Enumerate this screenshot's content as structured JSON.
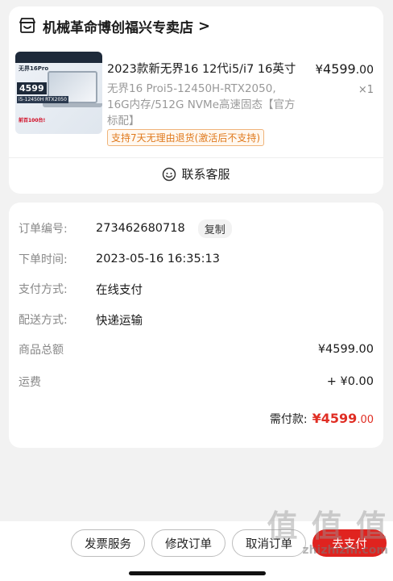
{
  "store": {
    "name": "机械革命博创福兴专卖店",
    "chevron": ">",
    "icon": "store-icon"
  },
  "product": {
    "title": "2023款新无界16 12代i5/i7 16英寸",
    "spec": "无界16 Proi5-12450H-RTX2050, 16G内存/512G NVMe高速固态【官方标配】",
    "price_currency": "¥",
    "price_int": "4599",
    "price_dec": ".00",
    "quantity": "×1",
    "return_policy": "支持7天无理由退货(激活后不支持)",
    "thumb": {
      "brand": "无界16Pro",
      "price": "4599",
      "spec": "i5-12450H RTX2050",
      "promo": "前百100台!"
    }
  },
  "service": {
    "label": "联系客服",
    "icon": "customer-service-icon"
  },
  "order": {
    "number_label": "订单编号:",
    "number": "273462680718",
    "copy_label": "复制",
    "time_label": "下单时间:",
    "time": "2023-05-16 16:35:13",
    "payment_label": "支付方式:",
    "payment": "在线支付",
    "delivery_label": "配送方式:",
    "delivery": "快递运输",
    "goods_total_label": "商品总额",
    "goods_total": "¥4599.00",
    "shipping_label": "运费",
    "shipping": "+ ¥0.00",
    "paid_label": "需付款:",
    "paid_currency": "¥",
    "paid_int": "4599",
    "paid_dec": ".00"
  },
  "actions": {
    "invoice": "发票服务",
    "modify": "修改订单",
    "cancel": "取消订单",
    "pay": "去支付"
  },
  "watermark": {
    "big": "值 值 值",
    "small": "zhizhizhi.com"
  },
  "colors": {
    "accent": "#e02e24",
    "tag_text": "#e07a1e",
    "background": "#f2f2f2"
  }
}
